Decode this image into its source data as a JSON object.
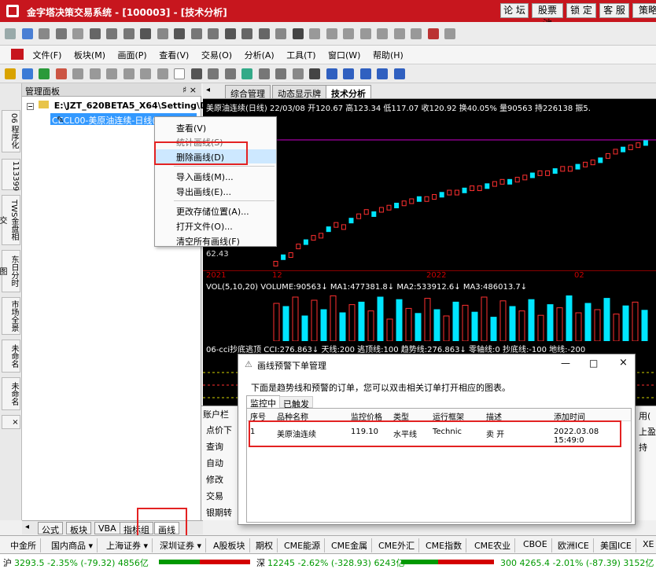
{
  "titlebar": {
    "title": "金字塔决策交易系统 - [100003] - [技术分析]",
    "buttons": [
      "论 坛",
      "股票池",
      "锁 定",
      "客 服",
      "策略"
    ]
  },
  "menu": [
    "文件(F)",
    "板块(M)",
    "画面(P)",
    "查看(V)",
    "交易(O)",
    "分析(A)",
    "工具(T)",
    "窗口(W)",
    "帮助(H)"
  ],
  "left_vtabs": [
    "06 程序化",
    "113399",
    "TWS金盘相交",
    "东日分时图",
    "市场全景",
    "未命名",
    "未命名",
    "×"
  ],
  "manager": {
    "title": "管理面板",
    "pin": "♯ ×",
    "root": "E:\\JZT_620BETA5_X64\\Setting\\Draw",
    "file": "CECL00-美原油连续-日线(1)"
  },
  "chart_tabs": [
    "综合管理",
    "动态显示牌",
    "技术分析"
  ],
  "chart": {
    "info": "美原油连续(日线) 22/03/08 开120.67 高123.34 低117.07 收120.92 换40.05% 量90563 持226138 振5.",
    "low_label": "62.43",
    "time_labels": [
      "2021",
      "12",
      "2022",
      "02"
    ],
    "volume_line": "VOL(5,10,20) VOLUME:90563↓ MA1:477381.8↓ MA2:533912.6↓ MA3:486013.7↓",
    "cci_line": "06-cci抄底逃顶 CCI:276.863↓ 天线:200 逃顶线:100 趋势线:276.863↓ 零轴线:0 抄底线:-100 地线:-200",
    "candles": [
      62,
      65,
      66,
      70,
      72,
      74,
      75,
      78,
      80,
      79,
      82,
      84,
      86,
      85,
      87,
      88,
      89,
      90,
      91,
      92,
      92,
      93,
      94,
      95,
      95,
      96,
      97,
      97,
      98,
      99,
      100,
      100,
      101,
      102,
      103,
      104,
      104,
      105,
      106,
      106,
      107,
      108,
      109,
      110,
      112,
      114,
      115,
      116,
      117,
      118
    ],
    "volumes": [
      60,
      55,
      70,
      40,
      65,
      50,
      72,
      45,
      58,
      62,
      48,
      70,
      35,
      66,
      52,
      44,
      68,
      50,
      40,
      62,
      57,
      46,
      70,
      38,
      64,
      55,
      48,
      66,
      41,
      58,
      53,
      72,
      45,
      60,
      50,
      68,
      43,
      56,
      62,
      49
    ]
  },
  "context_menu": {
    "items": [
      "查看(V)",
      "统计画线(S)",
      "删除画线(D)",
      "导入画线(M)...",
      "导出画线(E)...",
      "更改存储位置(A)...",
      "打开文件(O)...",
      "清空所有画线(F)"
    ],
    "selected": "删除画线(D)"
  },
  "dialog": {
    "title": "画线预警下单管理",
    "description": "下面是趋势线和预警的订单，您可以双击相关订单打开相应的图表。",
    "tabs": [
      "监控中",
      "已触发"
    ],
    "columns": [
      "序号",
      "品种名称",
      "监控价格",
      "类型",
      "运行框架",
      "描述",
      "添加时间"
    ],
    "rows": [
      {
        "id": "1",
        "name": "美原油连续",
        "price": "119.10",
        "type": "水平线",
        "framework": "Technic",
        "desc": "卖 开",
        "time": "2022.03.08 15:49:0"
      }
    ],
    "controls": [
      "—",
      "□",
      "×"
    ]
  },
  "account": {
    "title": "账户栏",
    "items": [
      "点价下",
      "查询",
      "自动",
      "修改",
      "交易",
      "银期转"
    ],
    "right_items": [
      "用(",
      "上盈",
      "持"
    ]
  },
  "bottom_tabs": [
    "公式",
    "板块",
    "VBA",
    "指标组",
    "画线"
  ],
  "market_tabs": [
    "中金所",
    "国内商品 ▾",
    "上海证券 ▾",
    "深圳证券 ▾",
    "A股板块",
    "期权",
    "CME能源",
    "CME金属",
    "CME外汇",
    "CME指数",
    "CME农业",
    "CBOE",
    "欧洲ICE",
    "美国ICE",
    "XE"
  ],
  "status": {
    "sh_label": "沪",
    "sh_value": "3293.5 -2.35% (-79.32) 4856亿",
    "sz_label": "深",
    "sz_value": "12245 -2.62% (-328.93) 6243亿",
    "idx_value": "300 4265.4 -2.01% (-87.39) 3152亿"
  },
  "colors": {
    "title_red": "#c7161e",
    "chart_bg": "#000000",
    "up": "#00e5ff",
    "down": "#ff3030",
    "highlight": "#e32222",
    "selection": "#3399ff"
  }
}
